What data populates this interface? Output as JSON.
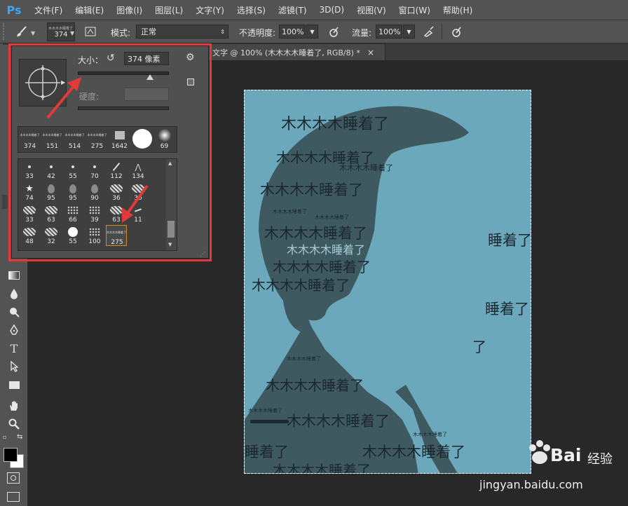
{
  "app": {
    "logo": "Ps"
  },
  "menu": {
    "items": [
      "文件(F)",
      "编辑(E)",
      "图像(I)",
      "图层(L)",
      "文字(Y)",
      "选择(S)",
      "滤镜(T)",
      "3D(D)",
      "视图(V)",
      "窗口(W)",
      "帮助(H)"
    ]
  },
  "options": {
    "brush_size": "374",
    "brush_thumb_text": "木木木木睡着了",
    "mode_label": "模式:",
    "mode_value": "正常",
    "opacity_label": "不透明度:",
    "opacity_value": "100%",
    "flow_label": "流量:",
    "flow_value": "100%"
  },
  "document": {
    "tab_title": "文字 @ 100% (木木木木睡着了, RGB/8) *",
    "close": "×"
  },
  "brush_panel": {
    "size_label": "大小：",
    "size_value": "374 像素",
    "hardness_label": "硬度:",
    "size_fraction": 0.79,
    "recent": [
      {
        "label": "374",
        "kind": "text"
      },
      {
        "label": "151",
        "kind": "text"
      },
      {
        "label": "514",
        "kind": "text"
      },
      {
        "label": "275",
        "kind": "text"
      },
      {
        "label": "1642",
        "kind": "square"
      },
      {
        "label": "",
        "kind": "round-hard"
      },
      {
        "label": "69",
        "kind": "round-soft"
      }
    ],
    "recent_thumb_text": "木木木木睡着了",
    "presets": [
      [
        "33",
        "42",
        "55",
        "70",
        "112",
        "134"
      ],
      [
        "74",
        "95",
        "95",
        "90",
        "36",
        "36"
      ],
      [
        "33",
        "63",
        "66",
        "39",
        "63",
        "11"
      ],
      [
        "48",
        "32",
        "55",
        "100",
        "275",
        ""
      ]
    ],
    "selected_preset": "275"
  },
  "artwork": {
    "phrase": "木木木木睡着了",
    "small_phrase": "木木木木睡着了",
    "fragments": [
      "睡着了",
      "睡着了",
      "了",
      "睡着了"
    ],
    "faint_line": "木木木木睡着了"
  },
  "watermark": {
    "brand": "Bai",
    "brand2": "经验",
    "url": "jingyan.baidu.com"
  },
  "colors": {
    "accent_red": "#e03a3a",
    "canvas_blue": "#6ba8bb",
    "shadow_blue": "#3e5960",
    "ps_blue": "#36a7ff"
  }
}
